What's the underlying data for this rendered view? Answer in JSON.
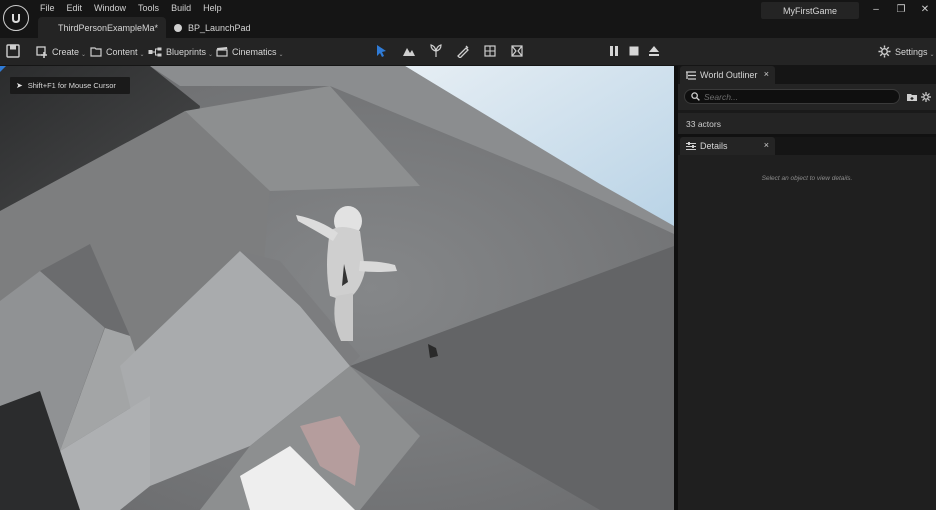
{
  "menu": [
    "File",
    "Edit",
    "Window",
    "Tools",
    "Build",
    "Help"
  ],
  "tabs": {
    "active": "ThirdPersonExampleMa*",
    "inactive": "BP_LaunchPad"
  },
  "project_name": "MyFirstGame",
  "window_controls": {
    "minimize": "–",
    "maximize": "❐",
    "close": "✕"
  },
  "toolbar": {
    "create": "Create",
    "content": "Content",
    "blueprints": "Blueprints",
    "cinematics": "Cinematics",
    "settings": "Settings"
  },
  "viewport": {
    "hint": "Shift+F1 for Mouse Cursor"
  },
  "world_outliner": {
    "title": "World Outliner",
    "close": "×",
    "search_placeholder": "Search...",
    "actors_count": "33 actors"
  },
  "details": {
    "title": "Details",
    "close": "×",
    "empty_message": "Select an object to view details."
  },
  "colors": {
    "accent_blue": "#2f7bd6",
    "panel_bg": "#242424",
    "menubar_bg": "#151515"
  }
}
